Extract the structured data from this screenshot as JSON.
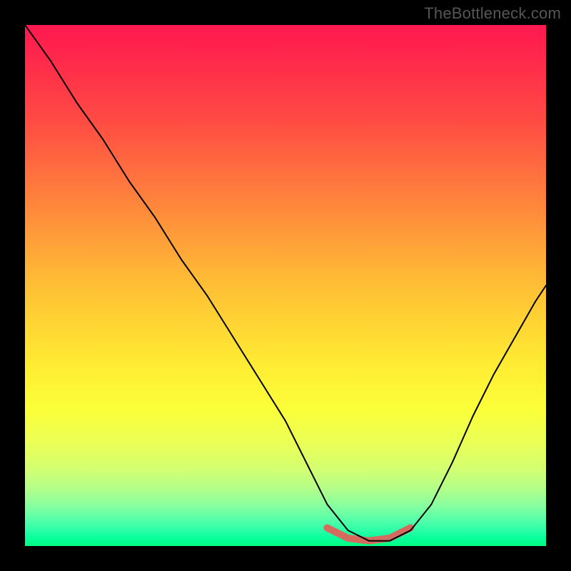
{
  "watermark": "TheBottleneck.com",
  "chart_data": {
    "type": "line",
    "title": "",
    "xlabel": "",
    "ylabel": "",
    "xlim": [
      0,
      1
    ],
    "ylim": [
      0,
      1
    ],
    "x": [
      0.0,
      0.05,
      0.1,
      0.15,
      0.2,
      0.25,
      0.3,
      0.35,
      0.4,
      0.45,
      0.5,
      0.55,
      0.58,
      0.62,
      0.66,
      0.7,
      0.74,
      0.78,
      0.82,
      0.86,
      0.9,
      0.94,
      0.98,
      1.0
    ],
    "values": [
      1.0,
      0.93,
      0.85,
      0.78,
      0.7,
      0.63,
      0.55,
      0.48,
      0.4,
      0.32,
      0.24,
      0.14,
      0.08,
      0.03,
      0.01,
      0.01,
      0.03,
      0.08,
      0.16,
      0.25,
      0.33,
      0.4,
      0.47,
      0.5
    ],
    "highlight_band": {
      "x": [
        0.58,
        0.62,
        0.66,
        0.7,
        0.74
      ],
      "values": [
        0.035,
        0.015,
        0.01,
        0.015,
        0.035
      ],
      "color": "#d56b5f"
    },
    "background_gradient": [
      "#ff1850",
      "#ff933a",
      "#ffee33",
      "#00ff83"
    ],
    "notes": "Axis values are normalized 0–1 (no tick labels visible in source image; values estimated from pixel positions)."
  }
}
